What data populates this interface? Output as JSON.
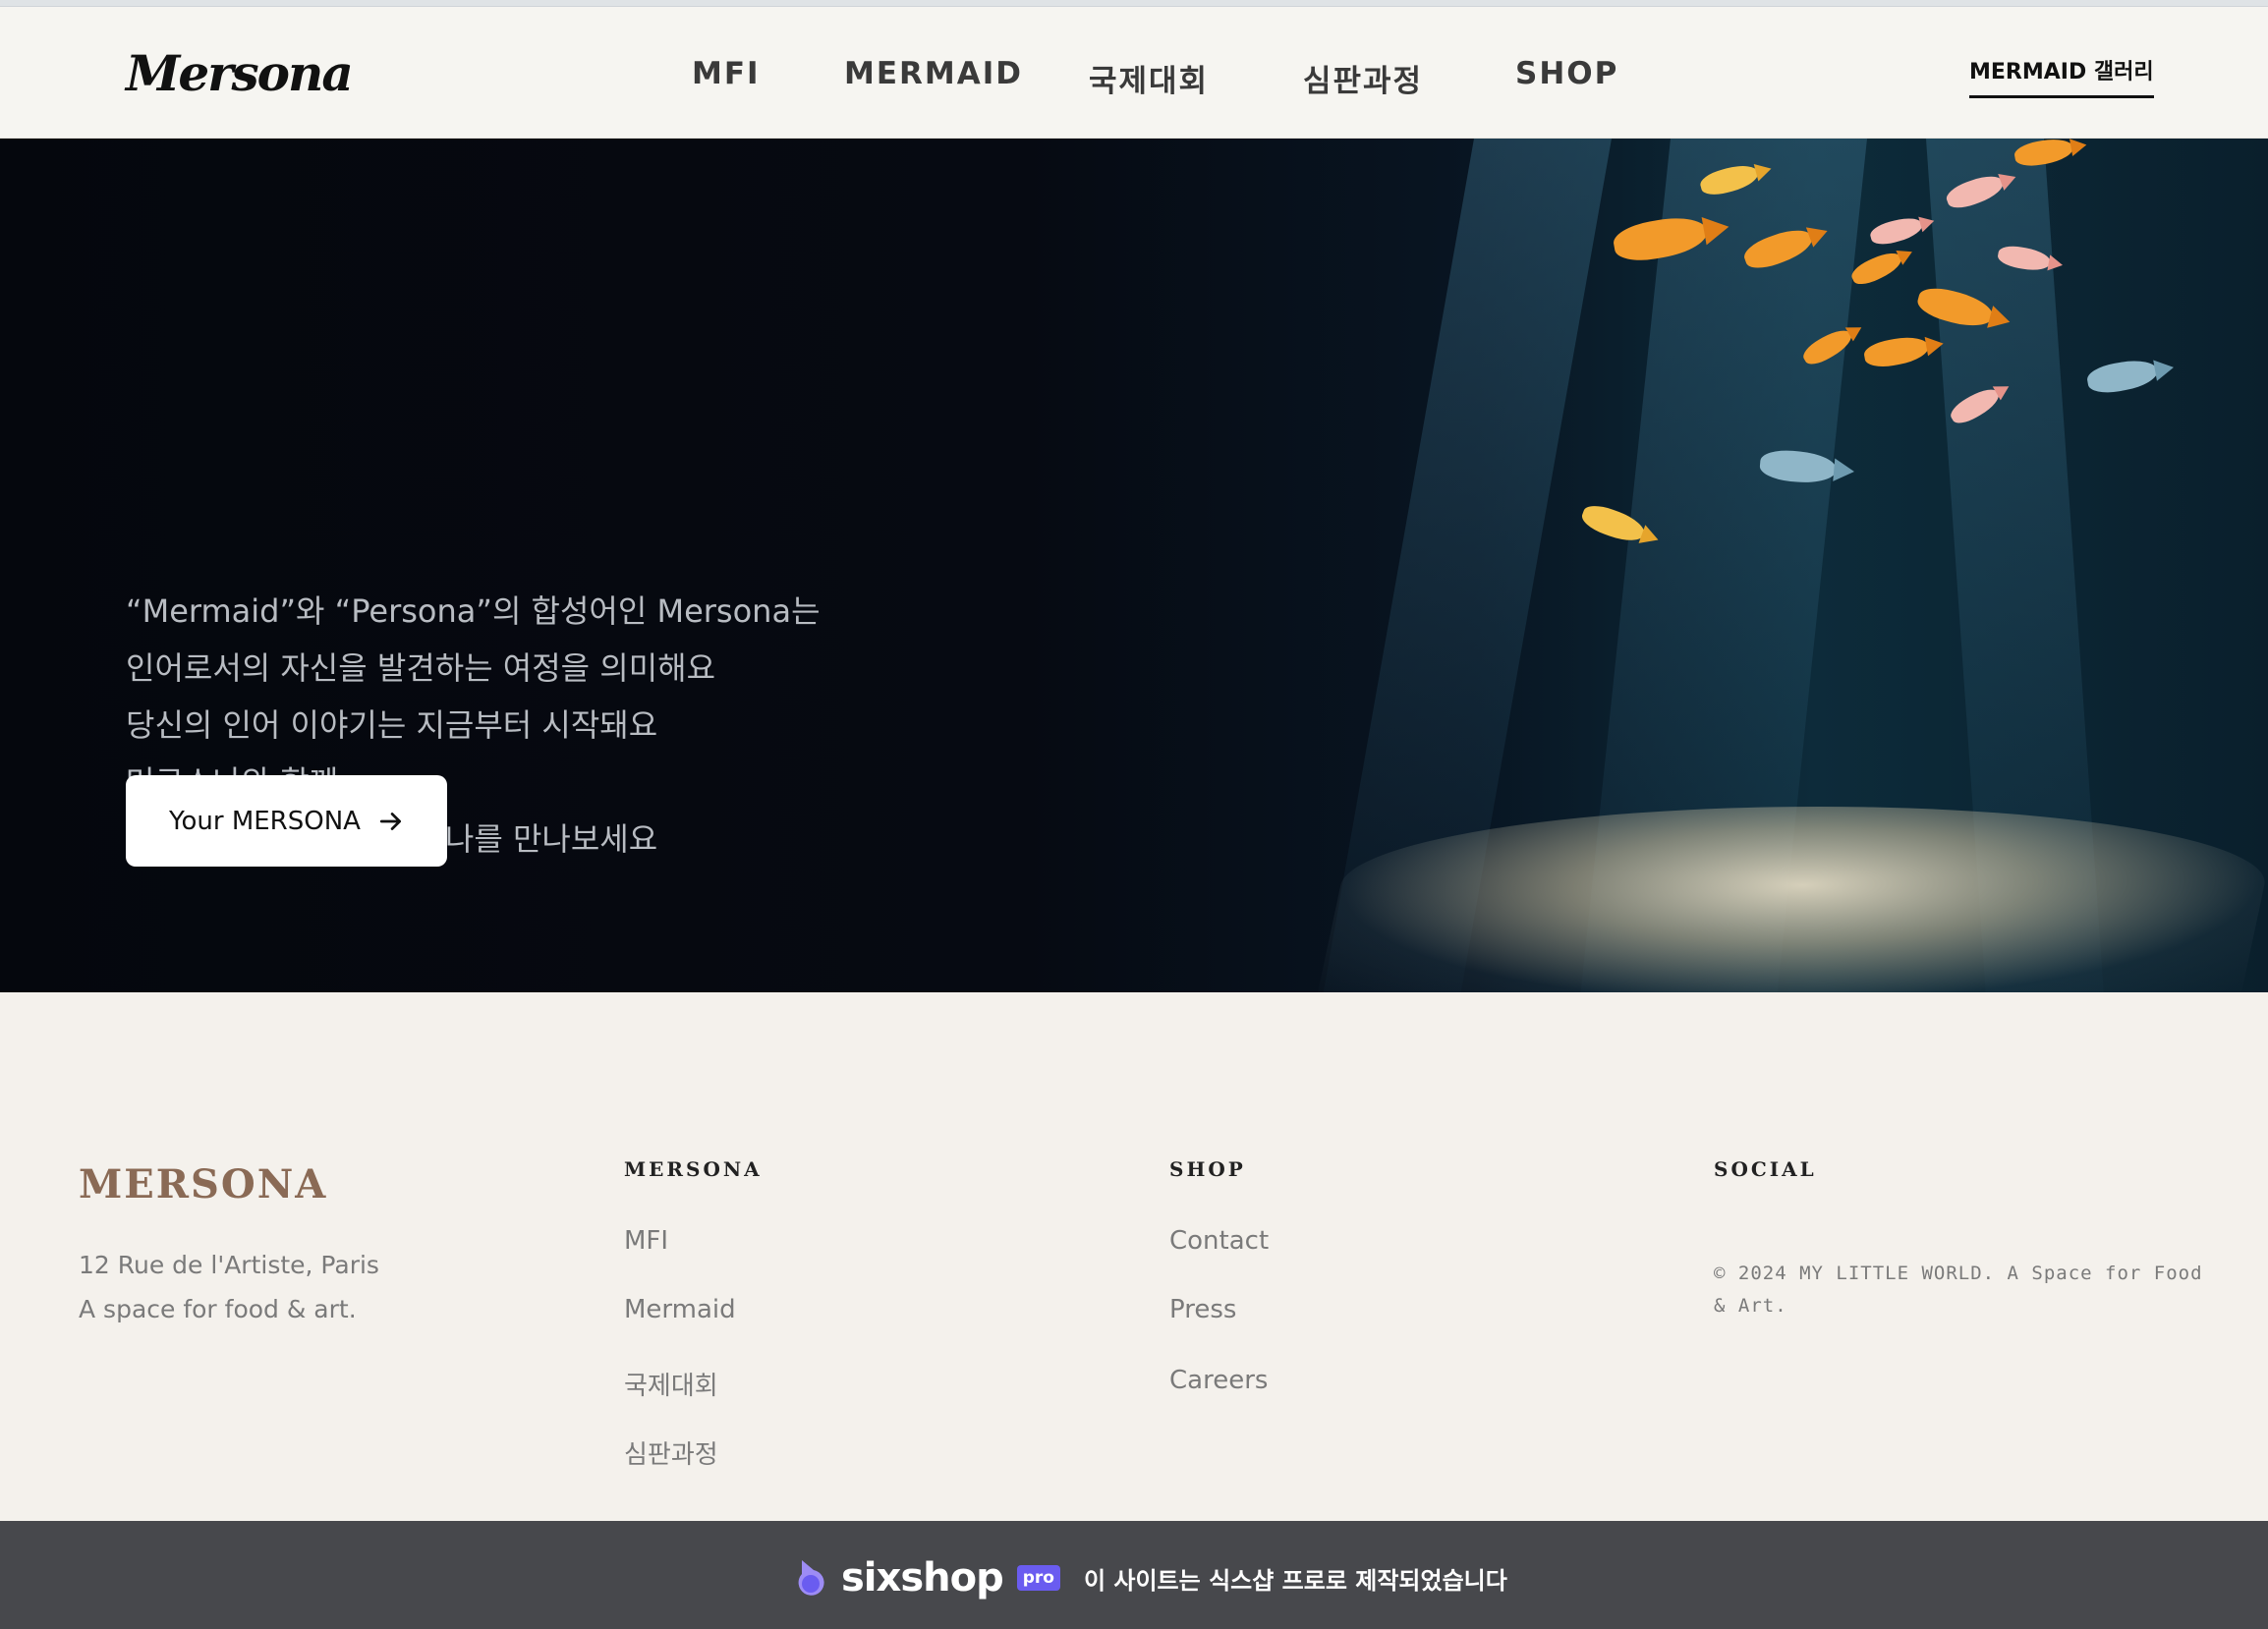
{
  "header": {
    "logo": "Mersona",
    "nav": [
      {
        "label": "MFI"
      },
      {
        "label": "MERMAID"
      },
      {
        "label": "국제대회"
      },
      {
        "label": "심판과정"
      },
      {
        "label": "SHOP"
      }
    ],
    "gallery_link": "MERMAID 갤러리"
  },
  "hero": {
    "lines": [
      "“Mermaid”와 “Persona”의 합성어인 Mersona는",
      "인어로서의 자신을 발견하는 여정을 의미해요",
      "당신의 인어 이야기는 지금부터 시작돼요",
      "머르소나와 함께",
      "물속에서 꿈꾸는 또다른 나를 만나보세요"
    ],
    "cta_label": "Your MERSONA",
    "cta_icon": "arrow-right-icon"
  },
  "footer": {
    "brand": "MERSONA",
    "address_lines": [
      "12 Rue de l'Artiste, Paris",
      "A space for food & art."
    ],
    "columns": [
      {
        "title": "MERSONA",
        "links": [
          "MFI",
          "Mermaid",
          "국제대회",
          "심판과정"
        ]
      },
      {
        "title": "SHOP",
        "links": [
          "Contact",
          "Press",
          "Careers"
        ]
      },
      {
        "title": "SOCIAL",
        "links": []
      }
    ],
    "copyright": "© 2024 MY LITTLE WORLD. A Space for Food & Art."
  },
  "sixshop_bar": {
    "logo": "sixshop",
    "badge": "pro",
    "text": "이 사이트는 식스샵 프로로 제작되었습니다"
  },
  "colors": {
    "brand_brown": "#8a6a55",
    "pro_badge": "#6a5cf0",
    "footer_bar": "#47484c",
    "hero_bg": "#05070d"
  }
}
